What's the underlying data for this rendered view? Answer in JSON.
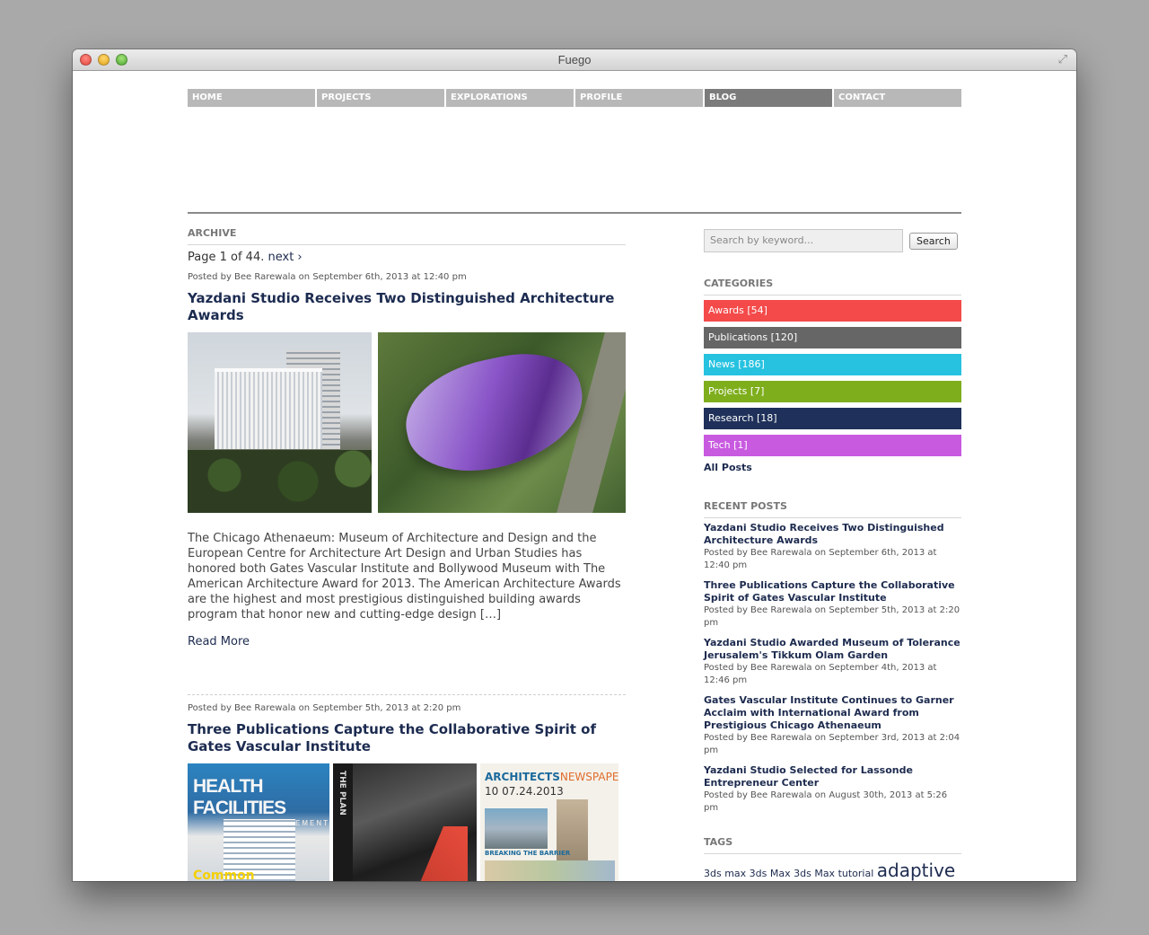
{
  "window": {
    "title": "Fuego"
  },
  "nav": [
    {
      "label": "HOME",
      "active": false
    },
    {
      "label": "PROJECTS",
      "active": false
    },
    {
      "label": "EXPLORATIONS",
      "active": false
    },
    {
      "label": "PROFILE",
      "active": false
    },
    {
      "label": "BLOG",
      "active": true
    },
    {
      "label": "CONTACT",
      "active": false
    }
  ],
  "archive": {
    "heading": "ARCHIVE",
    "pager_text": "Page 1 of 44.",
    "next_label": "next ›"
  },
  "posts": [
    {
      "meta": "Posted by Bee Rarewala on September 6th, 2013 at 12:40 pm",
      "title": "Yazdani Studio Receives Two Distinguished Architecture Awards",
      "excerpt": "The Chicago Athenaeum: Museum of Architecture and Design and the European Centre for Architecture Art Design and Urban Studies has honored both Gates Vascular Institute and Bollywood Museum with The American Architecture Award for 2013. The American Architecture Awards are the highest and most prestigious distinguished building awards program that honor new and cutting-edge design […]",
      "read_more": "Read More"
    },
    {
      "meta": "Posted by Bee Rarewala on September 5th, 2013 at 2:20 pm",
      "title": "Three Publications Capture the Collaborative Spirit of Gates Vascular Institute",
      "covers": {
        "magazine_title": "HEALTH FACILITIES",
        "magazine_sub": "MANAGEMENT",
        "magazine_cover_line": "Common",
        "plan_title": "THE PLAN",
        "paper_title_a": "ARCHITECTS",
        "paper_title_b": "NEWSPAPER",
        "paper_issue": "10   07.24.2013",
        "paper_headline": "BREAKING THE BARRIER"
      }
    }
  ],
  "sidebar": {
    "search_placeholder": "Search by keyword...",
    "search_button": "Search",
    "categories_heading": "CATEGORIES",
    "categories": [
      {
        "label": "Awards [54]",
        "color": "#f44a4a"
      },
      {
        "label": "Publications [120]",
        "color": "#666666"
      },
      {
        "label": "News [186]",
        "color": "#26c2e0"
      },
      {
        "label": "Projects [7]",
        "color": "#7eae1c"
      },
      {
        "label": "Research [18]",
        "color": "#1f315a"
      },
      {
        "label": "Tech [1]",
        "color": "#c85ae0"
      }
    ],
    "all_posts": "All Posts",
    "recent_heading": "RECENT POSTS",
    "recent": [
      {
        "title": "Yazdani Studio Receives Two Distinguished Architecture Awards",
        "meta": "Posted by Bee Rarewala on September 6th, 2013 at 12:40 pm"
      },
      {
        "title": "Three Publications Capture the Collaborative Spirit of Gates Vascular Institute",
        "meta": "Posted by Bee Rarewala on September 5th, 2013 at 2:20 pm"
      },
      {
        "title": "Yazdani Studio Awarded Museum of Tolerance Jerusalem's Tikkum Olam Garden",
        "meta": "Posted by Bee Rarewala on September 4th, 2013 at 12:46 pm"
      },
      {
        "title": "Gates Vascular Institute Continues to Garner Acclaim with International Award from Prestigious Chicago Athenaeum",
        "meta": "Posted by Bee Rarewala on September 3rd, 2013 at 2:04 pm"
      },
      {
        "title": "Yazdani Studio Selected for Lassonde Entrepreneur Center",
        "meta": "Posted by Bee Rarewala on August 30th, 2013 at 5:26 pm"
      }
    ],
    "tags_heading": "TAGS",
    "tags_small": "3ds max 3ds Max 3ds Max tutorial",
    "tags_big": "adaptive"
  }
}
